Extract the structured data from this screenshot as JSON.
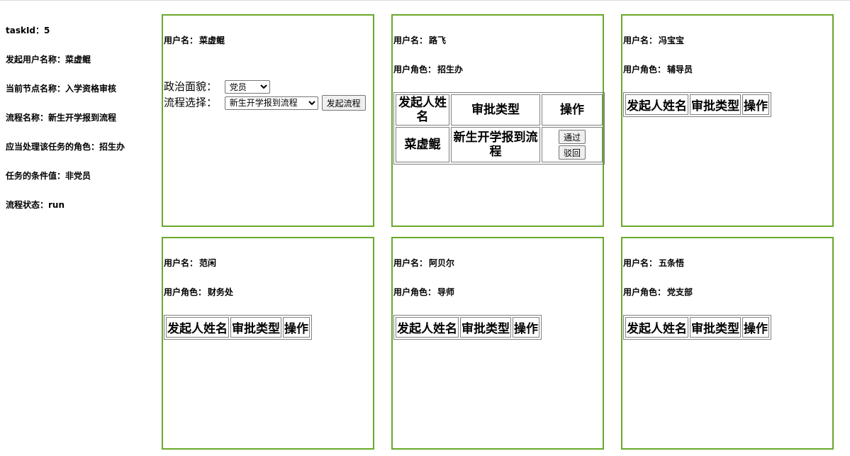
{
  "sidebar": {
    "task_id": "taskId：5",
    "initiator": "发起用户名称：菜虚鲲",
    "current_node": "当前节点名称：入学资格审核",
    "process_name": "流程名称：新生开学报到流程",
    "role": "应当处理该任务的角色：招生办",
    "condition": "任务的条件值：非党员",
    "status": "流程状态：run"
  },
  "labels": {
    "username": "用户名：",
    "role": "用户角色："
  },
  "panels": [
    {
      "username": "菜虚鲲",
      "form": {
        "politics_label": "政治面貌：",
        "politics_value": "党员",
        "process_label": "流程选择：",
        "process_value": "新生开学报到流程",
        "start_button": "发起流程"
      }
    },
    {
      "username": "路飞",
      "role": "招生办",
      "table": {
        "headers": [
          "发起人姓名",
          "审批类型",
          "操作"
        ],
        "rows": [
          {
            "initiator": "菜虚鲲",
            "type": "新生开学报到流程",
            "approve": "通过",
            "reject": "驳回"
          }
        ]
      }
    },
    {
      "username": "冯宝宝",
      "role": "辅导员",
      "table": {
        "headers": [
          "发起人姓名",
          "审批类型",
          "操作"
        ]
      }
    },
    {
      "username": "范闲",
      "role": "财务处",
      "table": {
        "headers": [
          "发起人姓名",
          "审批类型",
          "操作"
        ]
      }
    },
    {
      "username": "阿贝尔",
      "role": "导师",
      "table": {
        "headers": [
          "发起人姓名",
          "审批类型",
          "操作"
        ]
      }
    },
    {
      "username": "五条悟",
      "role": "党支部",
      "table": {
        "headers": [
          "发起人姓名",
          "审批类型",
          "操作"
        ]
      }
    }
  ],
  "colors": {
    "panel_border": "#6aa829"
  }
}
